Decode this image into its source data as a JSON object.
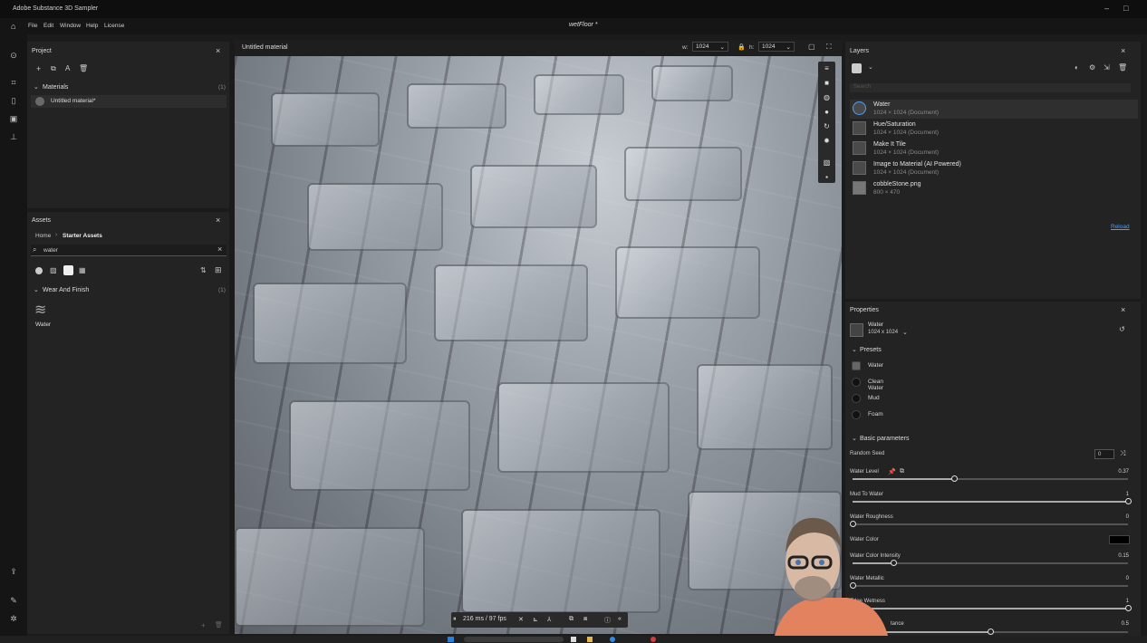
{
  "app_title": "Adobe Substance 3D Sampler",
  "window_controls": {
    "minimize": "–",
    "maximize": "□",
    "close": "×"
  },
  "menu": [
    "File",
    "Edit",
    "Window",
    "Help",
    "License"
  ],
  "document_title": "wetFloor *",
  "project": {
    "title": "Project",
    "materials_label": "Materials",
    "materials_count": "(1)",
    "items": [
      "Untitled material*"
    ]
  },
  "assets": {
    "title": "Assets",
    "breadcrumb": [
      "Home",
      "Starter Assets"
    ],
    "search_value": "water",
    "category": "Wear And Finish",
    "category_count": "(1)",
    "items": [
      "Water"
    ]
  },
  "viewport": {
    "title": "Untitled material",
    "w_label": "w:",
    "w_value": "1024",
    "h_label": "h:",
    "h_value": "1024",
    "perf": "216 ms / 97 fps"
  },
  "layers": {
    "title": "Layers",
    "search_placeholder": "Search",
    "items": [
      {
        "name": "Water",
        "sub": "1024 × 1024 (Document)"
      },
      {
        "name": "Hue/Saturation",
        "sub": "1024 × 1024 (Document)"
      },
      {
        "name": "Make It Tile",
        "sub": "1024 × 1024 (Document)"
      },
      {
        "name": "Image to Material (AI Powered)",
        "sub": "1024 × 1024 (Document)"
      },
      {
        "name": "cobbleStone.png",
        "sub": "800 × 470"
      }
    ],
    "reload": "Reload"
  },
  "properties": {
    "title": "Properties",
    "layer_name": "Water",
    "layer_size": "1024 x 1024",
    "presets_label": "Presets",
    "presets": [
      "Water",
      "Clean Water",
      "Mud",
      "Foam"
    ],
    "basic_label": "Basic parameters",
    "random_seed_label": "Random Seed",
    "random_seed_value": "0",
    "params": [
      {
        "label": "Water Level",
        "value": "0.37",
        "level": 0.37
      },
      {
        "label": "Mud To Water",
        "value": "1",
        "level": 1
      },
      {
        "label": "Water Roughness",
        "value": "0",
        "level": 0
      },
      {
        "label": "Water Color Intensity",
        "value": "0.15",
        "level": 0.15
      },
      {
        "label": "Water Metallic",
        "value": "0",
        "level": 0
      },
      {
        "label": "Edge Wetness",
        "value": "1",
        "level": 1
      },
      {
        "label": "tance",
        "value": "0.5",
        "level": 0.5
      }
    ],
    "water_color_label": "Water Color",
    "water_color": "#000000"
  },
  "colors": {
    "accent": "#4a9eff",
    "panel": "#232323"
  }
}
